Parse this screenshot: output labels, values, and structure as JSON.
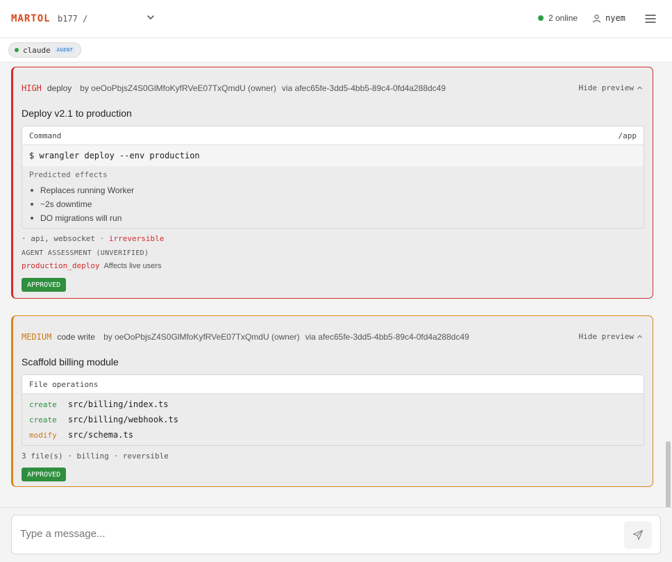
{
  "header": {
    "brand": "MARTOL",
    "room_prefix": "b177 /",
    "online": "2 online",
    "username": "nyem"
  },
  "presence": {
    "name": "claude",
    "badge": "AGENT"
  },
  "cards": [
    {
      "severity": "HIGH",
      "type": "deploy",
      "by": "by oeOoPbjsZ4S0GlMfoKyfRVeE07TxQmdU (owner)",
      "via": "via afec65fe-3dd5-4bb5-89c4-0fd4a288dc49",
      "hide": "Hide preview",
      "title": "Deploy v2.1 to production",
      "box_label": "Command",
      "box_path": "/app",
      "command": "$ wrangler deploy --env production",
      "effects_label": "Predicted effects",
      "effects": [
        "Replaces running Worker",
        "~2s downtime",
        "DO migrations will run"
      ],
      "meta_prefix": "· api, websocket ·",
      "meta_flag": "irreversible",
      "assessment_label": "AGENT ASSESSMENT (UNVERIFIED)",
      "assessment_tag": "production_deploy",
      "assessment_text": "Affects live users",
      "status": "APPROVED"
    },
    {
      "severity": "MEDIUM",
      "type": "code write",
      "by": "by oeOoPbjsZ4S0GlMfoKyfRVeE07TxQmdU (owner)",
      "via": "via afec65fe-3dd5-4bb5-89c4-0fd4a288dc49",
      "hide": "Hide preview",
      "title": "Scaffold billing module",
      "box_label": "File operations",
      "fileops": [
        {
          "action": "create",
          "path": "src/billing/index.ts"
        },
        {
          "action": "create",
          "path": "src/billing/webhook.ts"
        },
        {
          "action": "modify",
          "path": "src/schema.ts"
        }
      ],
      "meta": "3 file(s) · billing · reversible",
      "status": "APPROVED"
    }
  ],
  "composer": {
    "placeholder": "Type a message..."
  },
  "colors": {
    "brand": "#d9481c",
    "high": "#d22b2b",
    "medium": "#d88517",
    "approved": "#2f8f3e",
    "online": "#2ea043"
  }
}
